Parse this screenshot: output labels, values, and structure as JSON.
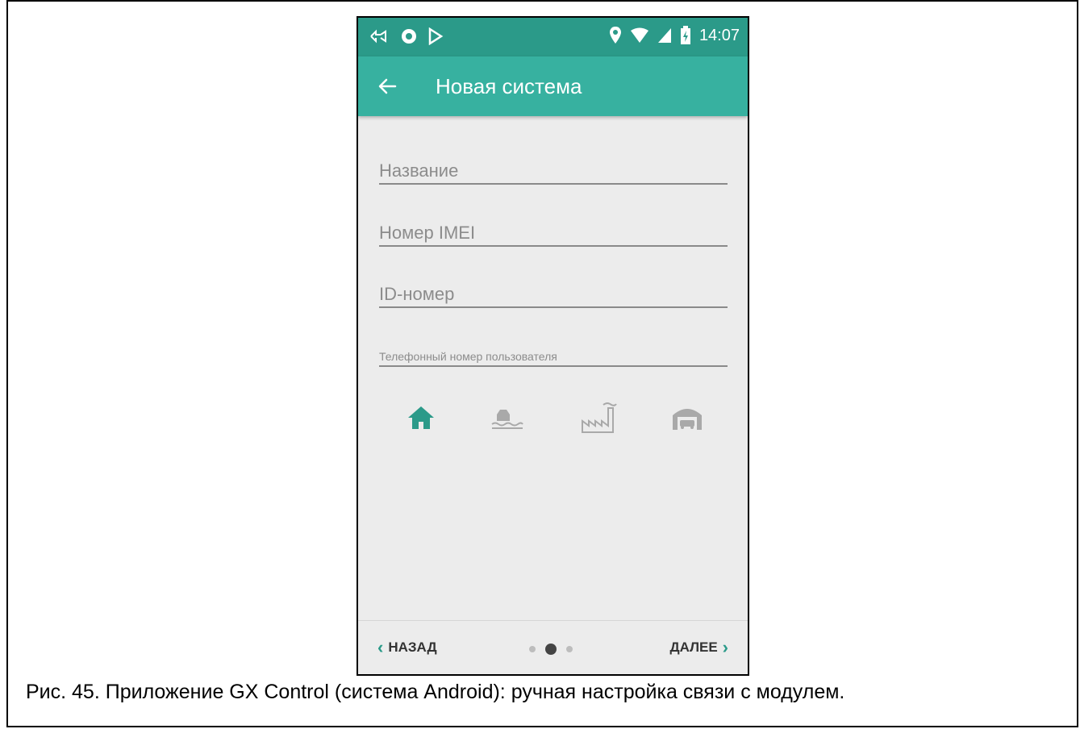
{
  "status_bar": {
    "time": "14:07",
    "left_icons": [
      "notification-icon",
      "circle-icon",
      "play-icon"
    ],
    "right_icons": [
      "location-icon",
      "wifi-icon",
      "signal-icon",
      "battery-icon"
    ]
  },
  "app_bar": {
    "title": "Новая система",
    "back_icon": "arrow-back-icon",
    "color": "#37b1a0"
  },
  "form": {
    "name_placeholder": "Название",
    "imei_placeholder": "Номер IMEI",
    "id_placeholder": "ID-номер",
    "phone_placeholder": "Телефонный номер пользователя"
  },
  "object_types": [
    {
      "icon": "house-icon",
      "selected": true
    },
    {
      "icon": "lake-house-icon",
      "selected": false
    },
    {
      "icon": "factory-icon",
      "selected": false
    },
    {
      "icon": "garage-icon",
      "selected": false
    }
  ],
  "bottom_nav": {
    "back_label": "НАЗАД",
    "next_label": "ДАЛЕЕ",
    "pages": 3,
    "current_page": 2
  },
  "caption": "Рис. 45. Приложение GX Control (система Android): ручная настройка связи с модулем."
}
